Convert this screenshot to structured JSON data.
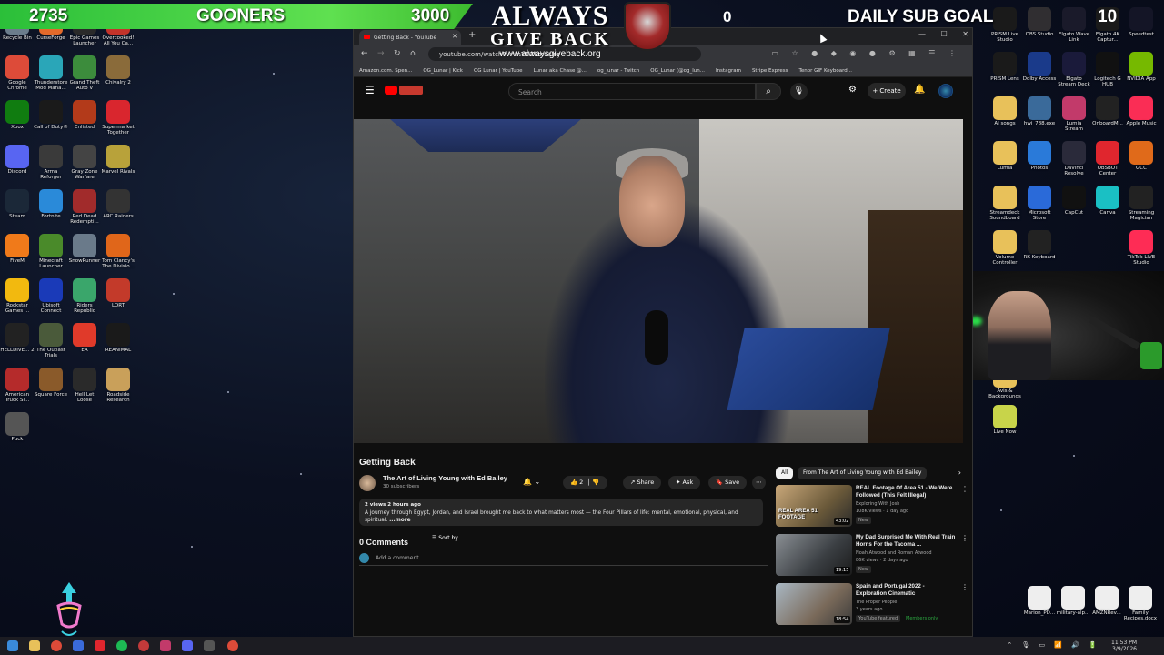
{
  "overlay": {
    "left_count": "2735",
    "goal_label": "GOONERS",
    "goal_target": "3000",
    "logo_line1": "ALWAYS",
    "logo_line2": "GIVE BACK",
    "logo_url": "www.alwaysgiveback.org",
    "sub_count": "0",
    "sub_goal_label": "DAILY SUB GOAL",
    "sub_goal_target": "10"
  },
  "desktop_left": [
    {
      "label": "Recycle Bin",
      "icon": "recycle-bin-icon",
      "color": "#6b7d8c"
    },
    {
      "label": "CurseForge",
      "icon": "curseforge-icon",
      "color": "#e36a2b"
    },
    {
      "label": "Epic Games Launcher",
      "icon": "epic-games-icon",
      "color": "#2a2a2a"
    },
    {
      "label": "Overcooked! All You Ca...",
      "icon": "overcooked-icon",
      "color": "#c4332a"
    },
    {
      "label": "Google Chrome",
      "icon": "chrome-icon",
      "color": "#dd4b39"
    },
    {
      "label": "Thunderstore Mod Mana...",
      "icon": "thunderstore-icon",
      "color": "#2aa6b8"
    },
    {
      "label": "Grand Theft Auto V",
      "icon": "gta-icon",
      "color": "#3c8c3c"
    },
    {
      "label": "Chivalry 2",
      "icon": "chivalry-icon",
      "color": "#8a6b3a"
    },
    {
      "label": "Xbox",
      "icon": "xbox-icon",
      "color": "#107c10"
    },
    {
      "label": "Call of Duty®",
      "icon": "cod-icon",
      "color": "#1a1a1a"
    },
    {
      "label": "Enlisted",
      "icon": "enlisted-icon",
      "color": "#b33a1a"
    },
    {
      "label": "Supermarket Together",
      "icon": "supermarket-icon",
      "color": "#d9262e"
    },
    {
      "label": "Discord",
      "icon": "discord-icon",
      "color": "#5865f2"
    },
    {
      "label": "Arma Reforger",
      "icon": "arma-icon",
      "color": "#3a3a3a"
    },
    {
      "label": "Gray Zone Warfare",
      "icon": "grayzone-icon",
      "color": "#444"
    },
    {
      "label": "Marvel Rivals",
      "icon": "marvel-icon",
      "color": "#b8a23a"
    },
    {
      "label": "Steam",
      "icon": "steam-icon",
      "color": "#1b2838"
    },
    {
      "label": "Fortnite",
      "icon": "fortnite-icon",
      "color": "#2a8ad9"
    },
    {
      "label": "Red Dead Redempti...",
      "icon": "rdr-icon",
      "color": "#a12b2b"
    },
    {
      "label": "ARC Raiders",
      "icon": "arc-raiders-icon",
      "color": "#333"
    },
    {
      "label": "FiveM",
      "icon": "fivem-icon",
      "color": "#f07a1a"
    },
    {
      "label": "Minecraft Launcher",
      "icon": "minecraft-icon",
      "color": "#4a8a2a"
    },
    {
      "label": "SnowRunner",
      "icon": "snowrunner-icon",
      "color": "#6a7a8a"
    },
    {
      "label": "Tom Clancy's The Divisio...",
      "icon": "division-icon",
      "color": "#e0661a"
    },
    {
      "label": "Rockstar Games ...",
      "icon": "rockstar-icon",
      "color": "#f2b90f"
    },
    {
      "label": "Ubisoft Connect",
      "icon": "ubisoft-icon",
      "color": "#1a3ab8"
    },
    {
      "label": "Riders Republic",
      "icon": "riders-icon",
      "color": "#3aa66b"
    },
    {
      "label": "LORT",
      "icon": "lort-icon",
      "color": "#c33a2a"
    },
    {
      "label": "HELLDIVE... 2",
      "icon": "helldivers-icon",
      "color": "#222"
    },
    {
      "label": "The Outlast Trials",
      "icon": "outlast-icon",
      "color": "#4a5a3a"
    },
    {
      "label": "EA",
      "icon": "ea-icon",
      "color": "#e03a2a"
    },
    {
      "label": "REANIMAL",
      "icon": "reanimal-icon",
      "color": "#1a1a1a"
    },
    {
      "label": "American Truck Si...",
      "icon": "ats-icon",
      "color": "#b52b2b"
    },
    {
      "label": "Square Force",
      "icon": "square-force-icon",
      "color": "#8a5a2a"
    },
    {
      "label": "Hell Let Loose",
      "icon": "hll-icon",
      "color": "#2a2a2a"
    },
    {
      "label": "Roadside Research",
      "icon": "roadside-icon",
      "color": "#c9a05a"
    },
    {
      "label": "Puck",
      "icon": "puck-icon",
      "color": "#555"
    }
  ],
  "desktop_right": [
    {
      "label": "PRISM Live Studio",
      "icon": "prism-icon",
      "color": "#1a1a1a"
    },
    {
      "label": "OBS Studio",
      "icon": "obs-icon",
      "color": "#302e31"
    },
    {
      "label": "Elgato Wave Link",
      "icon": "wave-link-icon",
      "color": "#1a1a2a"
    },
    {
      "label": "Elgato 4K Captur...",
      "icon": "elgato-4k-icon",
      "color": "#1a1a1a"
    },
    {
      "label": "Speedtest",
      "icon": "speedtest-icon",
      "color": "#141526"
    },
    {
      "label": "PRISM Lens",
      "icon": "prism-lens-icon",
      "color": "#1a1a1a"
    },
    {
      "label": "Dolby Access",
      "icon": "dolby-icon",
      "color": "#1a3a8a"
    },
    {
      "label": "Elgato Stream Deck",
      "icon": "stream-deck-icon",
      "color": "#1a1a3a"
    },
    {
      "label": "Logitech G HUB",
      "icon": "ghub-icon",
      "color": "#111"
    },
    {
      "label": "NVIDIA App",
      "icon": "nvidia-icon",
      "color": "#76b900"
    },
    {
      "label": "AI songs",
      "icon": "folder-icon",
      "color": "#e8c15a"
    },
    {
      "label": "hwi_788.exe",
      "icon": "hwinfo-icon",
      "color": "#3a6a9a"
    },
    {
      "label": "Lumia Stream",
      "icon": "lumia-icon",
      "color": "#c23a6a"
    },
    {
      "label": "OnboardM...",
      "icon": "onboard-icon",
      "color": "#222"
    },
    {
      "label": "Apple Music",
      "icon": "apple-music-icon",
      "color": "#fa2d55"
    },
    {
      "label": "Lumia",
      "icon": "folder-icon",
      "color": "#e8c15a"
    },
    {
      "label": "Photos",
      "icon": "photos-icon",
      "color": "#2a7ad9"
    },
    {
      "label": "DaVinci Resolve",
      "icon": "davinci-icon",
      "color": "#2a2a3a"
    },
    {
      "label": "OBSBOT Center",
      "icon": "obsbot-icon",
      "color": "#e0262e"
    },
    {
      "label": "GCC",
      "icon": "gcc-icon",
      "color": "#e06a1a"
    },
    {
      "label": "Streamdeck Soundboard",
      "icon": "folder-icon",
      "color": "#e8c15a"
    },
    {
      "label": "Microsoft Store",
      "icon": "ms-store-icon",
      "color": "#2a6ad9"
    },
    {
      "label": "CapCut",
      "icon": "capcut-icon",
      "color": "#111"
    },
    {
      "label": "Canva",
      "icon": "canva-icon",
      "color": "#1ac0c4"
    },
    {
      "label": "Streaming Magician",
      "icon": "magician-icon",
      "color": "#222"
    },
    {
      "label": "Volume Controller",
      "icon": "folder-icon",
      "color": "#e8c15a"
    },
    {
      "label": "RK Keyboard",
      "icon": "rk-icon",
      "color": "#222"
    },
    {
      "label": "TikTok LIVE Studio",
      "icon": "tiktok-icon",
      "color": "#fe2c55"
    },
    {
      "label": "Avis & Backgrounds",
      "icon": "folder-icon",
      "color": "#e8c15a"
    },
    {
      "label": "Live Now",
      "icon": "folder-icon",
      "color": "#c8d44a"
    }
  ],
  "desktop_files": [
    {
      "label": "Marion_PD..."
    },
    {
      "label": "military-alp..."
    },
    {
      "label": "AMZNRev..."
    },
    {
      "label": "Family Recipes.docx"
    }
  ],
  "browser": {
    "tab_title": "Getting Back - YouTube",
    "url": "youtube.com/watch?v=mYDZLmuclrg",
    "bookmarks": [
      "Amazon.com. Spen...",
      "OG_Lunar | Kick",
      "OG Lunar | YouTube",
      "Lunar aka Chase @...",
      "og_lunar - Twitch",
      "OG_Lunar (@og_lun...",
      "Instagram",
      "Stripe Express",
      "Tenor GIF Keyboard..."
    ]
  },
  "youtube": {
    "search_placeholder": "Search",
    "create_label": "Create",
    "video_title": "Getting Back",
    "channel_name": "The Art of Living Young with Ed Bailey",
    "subscribers": "30 subscribers",
    "likes": "2",
    "share_label": "Share",
    "ask_label": "Ask",
    "save_label": "Save",
    "views_meta": "2 views  2 hours ago",
    "description": "A journey through Egypt, Jordan, and Israel brought me back to what matters most — the Four Pillars of life: mental, emotional, physical, and spiritual.",
    "more_label": "...more",
    "comments_count": "0 Comments",
    "sort_label": "Sort by",
    "comment_placeholder": "Add a comment...",
    "chip_all": "All",
    "chip_channel": "From The Art of Living Young with Ed Bailey",
    "recommendations": [
      {
        "title": "REAL Footage Of Area 51 - We Were Followed (This Felt Illegal)",
        "channel": "Exploring With Josh",
        "views": "108K views · 1 day ago",
        "badge": "New",
        "duration": "43:02",
        "thumb_text": "REAL AREA 51 FOOTAGE"
      },
      {
        "title": "My Dad Surprised Me With Real Train Horns For the Tacoma ...",
        "channel": "Noah Atwood and Roman Atwood",
        "views": "86K views · 2 days ago",
        "badge": "New",
        "duration": "19:15",
        "thumb_text": ""
      },
      {
        "title": "Spain and Portugal 2022 - Exploration Cinematic",
        "channel": "The Proper People",
        "views": "3 years ago",
        "badge": "YouTube featured",
        "badge2": "Members only",
        "duration": "18:54",
        "thumb_text": ""
      }
    ]
  },
  "taskbar": {
    "time": "11:53 PM",
    "date": "3/9/2026"
  }
}
